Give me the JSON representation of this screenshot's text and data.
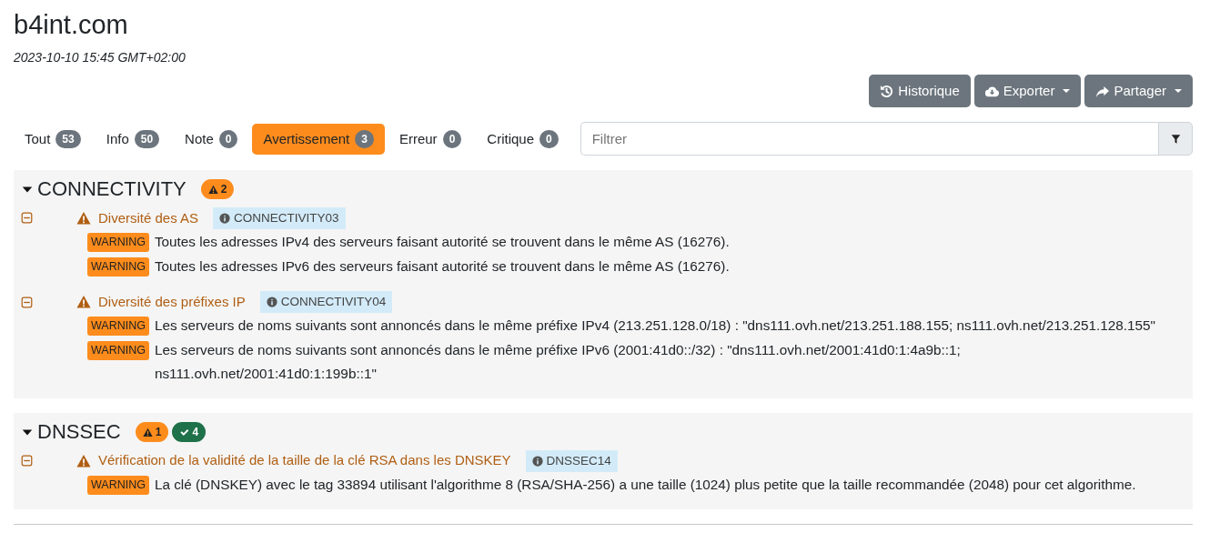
{
  "title": "b4int.com",
  "datetime": "2023-10-10 15:45 GMT+02:00",
  "toolbar": [
    {
      "kind": "history",
      "label": "Historique",
      "dropdown": false
    },
    {
      "kind": "export",
      "label": "Exporter",
      "dropdown": true
    },
    {
      "kind": "share",
      "label": "Partager",
      "dropdown": true
    }
  ],
  "filters": [
    {
      "label": "Tout",
      "count": "53",
      "selected": false
    },
    {
      "label": "Info",
      "count": "50",
      "selected": false
    },
    {
      "label": "Note",
      "count": "0",
      "selected": false
    },
    {
      "label": "Avertissement",
      "count": "3",
      "selected": true
    },
    {
      "label": "Erreur",
      "count": "0",
      "selected": false
    },
    {
      "label": "Critique",
      "count": "0",
      "selected": false
    }
  ],
  "filter_field": {
    "placeholder": "Filtrer"
  },
  "modules": [
    {
      "name": "CONNECTIVITY",
      "expanded": true,
      "badges": [
        {
          "kind": "warning",
          "count": "2"
        }
      ],
      "tests": [
        {
          "title": "Diversité des AS",
          "code": "CONNECTIVITY03",
          "expanded": true,
          "messages": [
            {
              "level": "WARNING",
              "text": "Toutes les adresses IPv4 des serveurs faisant autorité se trouvent dans le même AS (16276)."
            },
            {
              "level": "WARNING",
              "text": "Toutes les adresses IPv6 des serveurs faisant autorité se trouvent dans le même AS (16276)."
            }
          ]
        },
        {
          "title": "Diversité des préfixes IP",
          "code": "CONNECTIVITY04",
          "expanded": true,
          "messages": [
            {
              "level": "WARNING",
              "text": "Les serveurs de noms suivants sont annoncés dans le même préfixe IPv4 (213.251.128.0/18) : \"dns111.ovh.net/213.251.188.155; ns111.ovh.net/213.251.128.155\""
            },
            {
              "level": "WARNING",
              "text": "Les serveurs de noms suivants sont annoncés dans le même préfixe IPv6 (2001:41d0::/32) : \"dns111.ovh.net/2001:41d0:1:4a9b::1; ns111.ovh.net/2001:41d0:1:199b::1\""
            }
          ]
        }
      ]
    },
    {
      "name": "DNSSEC",
      "expanded": true,
      "badges": [
        {
          "kind": "warning",
          "count": "1"
        },
        {
          "kind": "ok",
          "count": "4"
        }
      ],
      "tests": [
        {
          "title": "Vérification de la validité de la taille de la clé RSA dans les DNSKEY",
          "code": "DNSSEC14",
          "expanded": true,
          "messages": [
            {
              "level": "WARNING",
              "text": "La clé (DNSKEY) avec le tag 33894 utilisant l'algorithme 8 (RSA/SHA-256) a une taille (1024) plus petite que la taille recommandée (2048) pour cet algorithme."
            }
          ]
        }
      ]
    }
  ]
}
